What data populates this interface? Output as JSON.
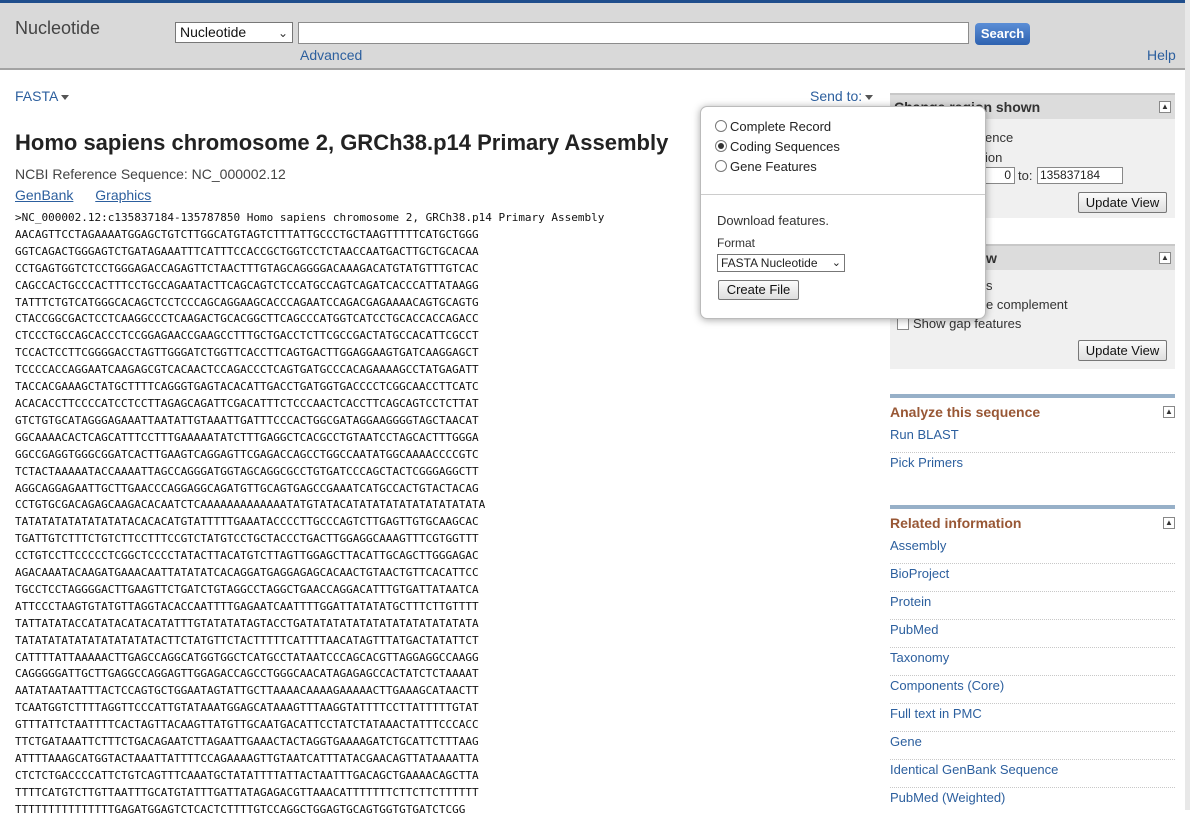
{
  "header": {
    "db_title": "Nucleotide",
    "db_select_value": "Nucleotide",
    "search_value": "",
    "search_button": "Search",
    "advanced_link": "Advanced",
    "help_link": "Help"
  },
  "toolbar": {
    "format_menu": "FASTA",
    "send_to": "Send to:"
  },
  "record": {
    "title": "Homo sapiens chromosome 2, GRCh38.p14 Primary Assembly",
    "ref_seq": "NCBI Reference Sequence: NC_000002.12",
    "links": [
      "GenBank",
      "Graphics"
    ],
    "fasta_header": ">NC_000002.12:c135837184-135787850 Homo sapiens chromosome 2, GRCh38.p14 Primary Assembly",
    "sequence_lines": [
      "AACAGTTCCTAGAAAATGGAGCTGTCTTGGCATGTAGTCTTTATTGCCCTGCTAAGTTTTTCATGCTGGG",
      "GGTCAGACTGGGAGTCTGATAGAAATTTCATTTCCACCGCTGGTCCTCTAACCAATGACTTGCTGCACAA",
      "CCTGAGTGGTCTCCTGGGAGACCAGAGTTCTAACTTTGTAGCAGGGGACAAAGACATGTATGTTTGTCAC",
      "CAGCCACTGCCCACTTTCCTGCCAGAATACTTCAGCAGTCTCCATGCCAGTCAGATCACCCATTATAAGG",
      "TATTTCTGTCATGGGCACAGCTCCTCCCAGCAGGAAGCACCCAGAATCCAGACGAGAAAACAGTGCAGTG",
      "CTACCGGCGACTCCTCAAGGCCCTCAAGACTGCACGGCTTCAGCCCATGGTCATCCTGCACCACCAGACC",
      "CTCCCTGCCAGCACCCTCCGGAGAACCGAAGCCTTTGCTGACCTCTTCGCCGACTATGCCACATTCGCCT",
      "TCCACTCCTTCGGGGACCTAGTTGGGATCTGGTTCACCTTCAGTGACTTGGAGGAAGTGATCAAGGAGCT",
      "TCCCCACCAGGAATCAAGAGCGTCACAACTCCAGACCCTCAGTGATGCCCACAGAAAAGCCTATGAGATT",
      "TACCACGAAAGCTATGCTTTTCAGGGTGAGTACACATTGACCTGATGGTGACCCCTCGGCAACCTTCATC",
      "ACACACCTTCCCCATCCTCCTTAGAGCAGATTCGACATTTCTCCCAACTCACCTTCAGCAGTCCTCTTAT",
      "GTCTGTGCATAGGGAGAAATTAATATTGTAAATTGATTTCCCACTGGCGATAGGAAGGGGTAGCTAACAT",
      "GGCAAAACACTCAGCATTTCCTTTGAAAAATATCTTTGAGGCTCACGCCTGTAATCCTAGCACTTTGGGA",
      "GGCCGAGGTGGGCGGATCACTTGAAGTCAGGAGTTCGAGACCAGCCTGGCCAATATGGCAAAACCCCGTC",
      "TCTACTAAAAATACCAAAATTAGCCAGGGATGGTAGCAGGCGCCTGTGATCCCAGCTACTCGGGAGGCTT",
      "AGGCAGGAGAATTGCTTGAACCCAGGAGGCAGATGTTGCAGTGAGCCGAAATCATGCCACTGTACTACAG",
      "CCTGTGCGACAGAGCAAGACACAATCTCAAAAAAAAAAAAATATGTATACATATATATATATATATATATA",
      "TATATATATATATATATACACACATGTATTTTTGAAATACCCCTTGCCCAGTCTTGAGTTGTGCAAGCAC",
      "TGATTGTCTTTCTGTCTTCCTTTCCGTCTATGTCCTGCTACCCTGACTTGGAGGCAAAGTTTCGTGGTTT",
      "CCTGTCCTTCCCCCTCGGCTCCCCTATACTTACATGTCTTAGTTGGAGCTTACATTGCAGCTTGGGAGAC",
      "AGACAAATACAAGATGAAACAATTATATATCACAGGATGAGGAGAGCACAACTGTAACTGTTCACATTCC",
      "TGCCTCCTAGGGGACTTGAAGTTCTGATCTGTAGGCCTAGGCTGAACCAGGACATTTGTGATTATAATCA",
      "ATTCCCTAAGTGTATGTTAGGTACACCAATTTTGAGAATCAATTTTGGATTATATATGCTTTCTTGTTTT",
      "TATTATATACCATATACATACATATTTGTATATATAGTACCTGATATATATATATATATATATATATATA",
      "TATATATATATATATATATATACTTCTATGTTCTACTTTTTCATTTTAACATAGTTTATGACTATATTCT",
      "CATTTTATTAAAAACTTGAGCCAGGCATGGTGGCTCATGCCTATAATCCCAGCACGTTAGGAGGCCAAGG",
      "CAGGGGGATTGCTTGAGGCCAGGAGTTGGAGACCAGCCTGGGCAACATAGAGAGCCACTATCTCTAAAAT",
      "AATATAATAATTTACTCCAGTGCTGGAATAGTATTGCTTAAAACAAAAGAAAAACTTGAAAGCATAACTT",
      "TCAATGGTCTTTTAGGTTCCCATTGTATAAATGGAGCATAAAGTTTAAGGTATTTTCCTTATTTTTGTAT",
      "GTTTATTCTAATTTTCACTAGTTACAAGTTATGTTGCAATGACATTCCTATCTATAAACTATTTCCCACC",
      "TTCTGATAAATTCTTTCTGACAGAATCTTAGAATTGAAACTACTAGGTGAAAAGATCTGCATTCTTTAAG",
      "ATTTTAAAGCATGGTACTAAATTATTTTCCAGAAAAGTTGTAATCATTTATACGAACAGTTATAAAATTA",
      "CTCTCTGACCCCATTCTGTCAGTTTCAAATGCTATATTTTATTACTAATTTGACAGCTGAAAACAGCTTA",
      "TTTTCATGTCTTGTTAATTTGCATGTATTTGATTATAGAGACGTTAAACATTTTTTTCTTCTTCTTTTTT",
      "TTTTTTTTTTTTTTTGAGATGGAGTCTCACTCTTTTGTCCAGGCTGGAGTGCAGTGGTGTGATCTCGG"
    ]
  },
  "popup": {
    "options": [
      {
        "label": "Complete Record",
        "selected": false
      },
      {
        "label": "Coding Sequences",
        "selected": true
      },
      {
        "label": "Gene Features",
        "selected": false
      }
    ],
    "download_label": "Download features.",
    "format_label": "Format",
    "format_value": "FASTA Nucleotide",
    "create_button": "Create File"
  },
  "change_region": {
    "title": "Change region shown",
    "option1_tail": "ence",
    "option2_tail": "ion",
    "from_value": "0",
    "to_label": "to:",
    "to_value": "135837184",
    "update_button": "Update View"
  },
  "customize_view": {
    "title_tail": "w",
    "option1_tail": "s",
    "option2_tail": "e complement",
    "option3": "Show gap features",
    "update_button": "Update View"
  },
  "analyze": {
    "title": "Analyze this sequence",
    "links": [
      "Run BLAST",
      "Pick Primers"
    ]
  },
  "related": {
    "title": "Related information",
    "links": [
      "Assembly",
      "BioProject",
      "Protein",
      "PubMed",
      "Taxonomy",
      "Components (Core)",
      "Full text in PMC",
      "Gene",
      "Identical GenBank Sequence",
      "PubMed (Weighted)"
    ]
  }
}
